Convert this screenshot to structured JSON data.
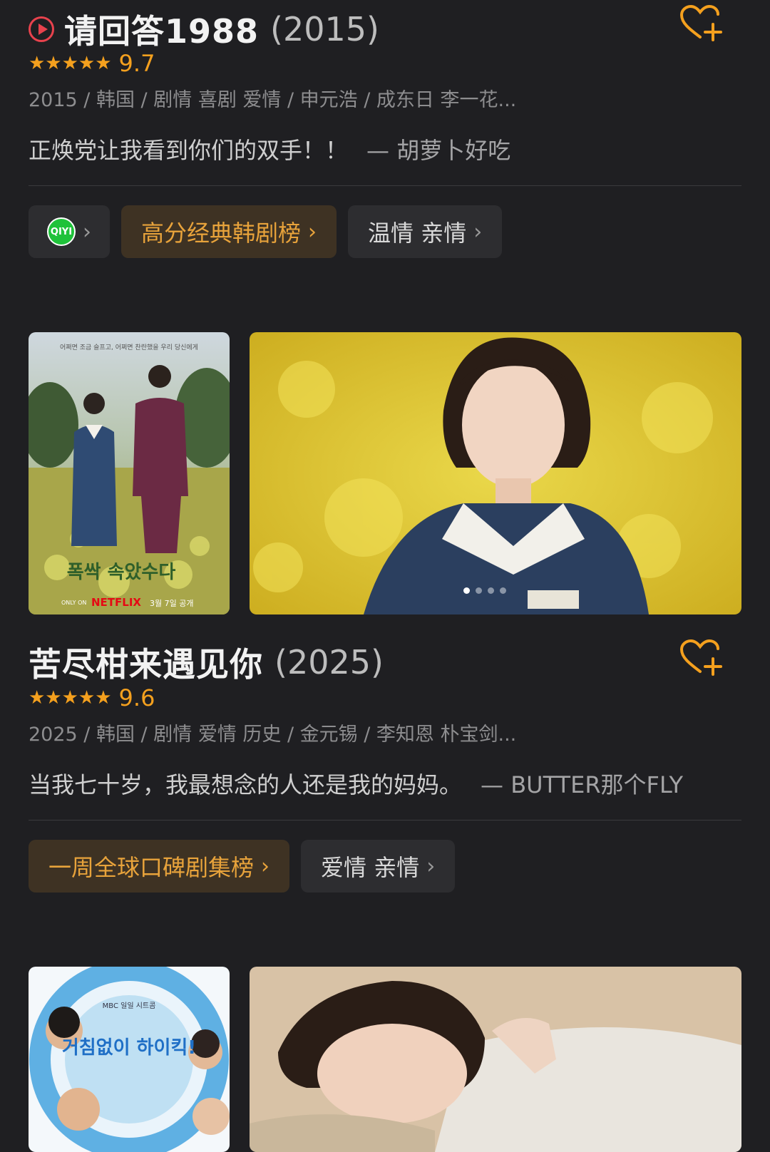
{
  "items": [
    {
      "title": "请回答1988",
      "year": "(2015)",
      "stars": "★★★★★",
      "score": "9.7",
      "meta": "2015 / 韩国 / 剧情 喜剧 爱情 / 申元浩 / 成东日 李一花...",
      "quote": "正焕党让我看到你们的双手！！",
      "quote_author": "— 胡萝卜好吃",
      "platform": "QIYI",
      "chips": [
        "高分经典韩剧榜",
        "温情 亲情"
      ]
    },
    {
      "title": "苦尽柑来遇见你",
      "year": "(2025)",
      "stars": "★★★★★",
      "score": "9.6",
      "meta": "2025 / 韩国 / 剧情 爱情 历史 / 金元锡 / 李知恩 朴宝剑...",
      "quote": "当我七十岁，我最想念的人还是我的妈妈。",
      "quote_author": "— BUTTER那个FLY",
      "chips": [
        "一周全球口碑剧集榜",
        "爱情 亲情"
      ],
      "poster_text": {
        "top": "어쩌면 조금 슬프고, 어쩌면 찬란했을 우리 당신에게",
        "title_kr": "폭싹 속았수다",
        "brand": "NETFLIX",
        "date": "3월 7일 공개",
        "only_on": "ONLY ON"
      }
    },
    {
      "poster_text": {
        "brand": "MBC 일일 시트콤",
        "title_kr": "거침없이 하이킥!"
      }
    }
  ],
  "colors": {
    "background": "#1f1f22",
    "accent": "#f4a01e",
    "chip_gold_bg": "#3e3223",
    "play_red": "#e8424d",
    "iqiyi_green": "#1fc23a"
  },
  "icons": [
    "play-circle-icon",
    "heart-plus-icon",
    "star-icon",
    "chevron-right-icon",
    "iqiyi-logo-icon"
  ]
}
